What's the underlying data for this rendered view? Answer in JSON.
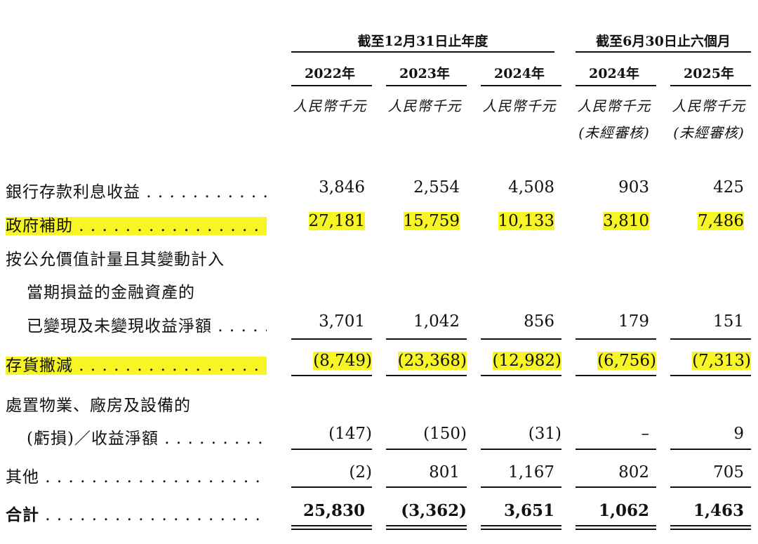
{
  "header": {
    "group_fy": "截至12月31日止年度",
    "group_half": "截至6月30日止六個月",
    "years": [
      "2022年",
      "2023年",
      "2024年",
      "2024年",
      "2025年"
    ],
    "unit": "人民幣千元",
    "unaudited": "(未經審核)"
  },
  "rows": [
    {
      "label": "銀行存款利息收益",
      "values": [
        "3,846",
        "2,554",
        "4,508",
        "903",
        "425"
      ]
    },
    {
      "label": "政府補助",
      "values": [
        "27,181",
        "15,759",
        "10,133",
        "3,810",
        "7,486"
      ]
    },
    {
      "label_lines": [
        "按公允價值計量且其變動計入",
        "當期損益的金融資產的",
        "已變現及未變現收益淨額"
      ],
      "values": [
        "3,701",
        "1,042",
        "856",
        "179",
        "151"
      ]
    },
    {
      "label": "存貨撇減",
      "values": [
        "(8,749)",
        "(23,368)",
        "(12,982)",
        "(6,756)",
        "(7,313)"
      ]
    },
    {
      "label_lines": [
        "處置物業、廠房及設備的",
        "(虧損)／收益淨額"
      ],
      "values": [
        "(147)",
        "(150)",
        "(31)",
        "–",
        "9"
      ]
    },
    {
      "label": "其他",
      "values": [
        "(2)",
        "801",
        "1,167",
        "802",
        "705"
      ]
    },
    {
      "label": "合計",
      "values": [
        "25,830",
        "(3,362)",
        "3,651",
        "1,062",
        "1,463"
      ]
    }
  ],
  "highlight_color": "#f8f525"
}
